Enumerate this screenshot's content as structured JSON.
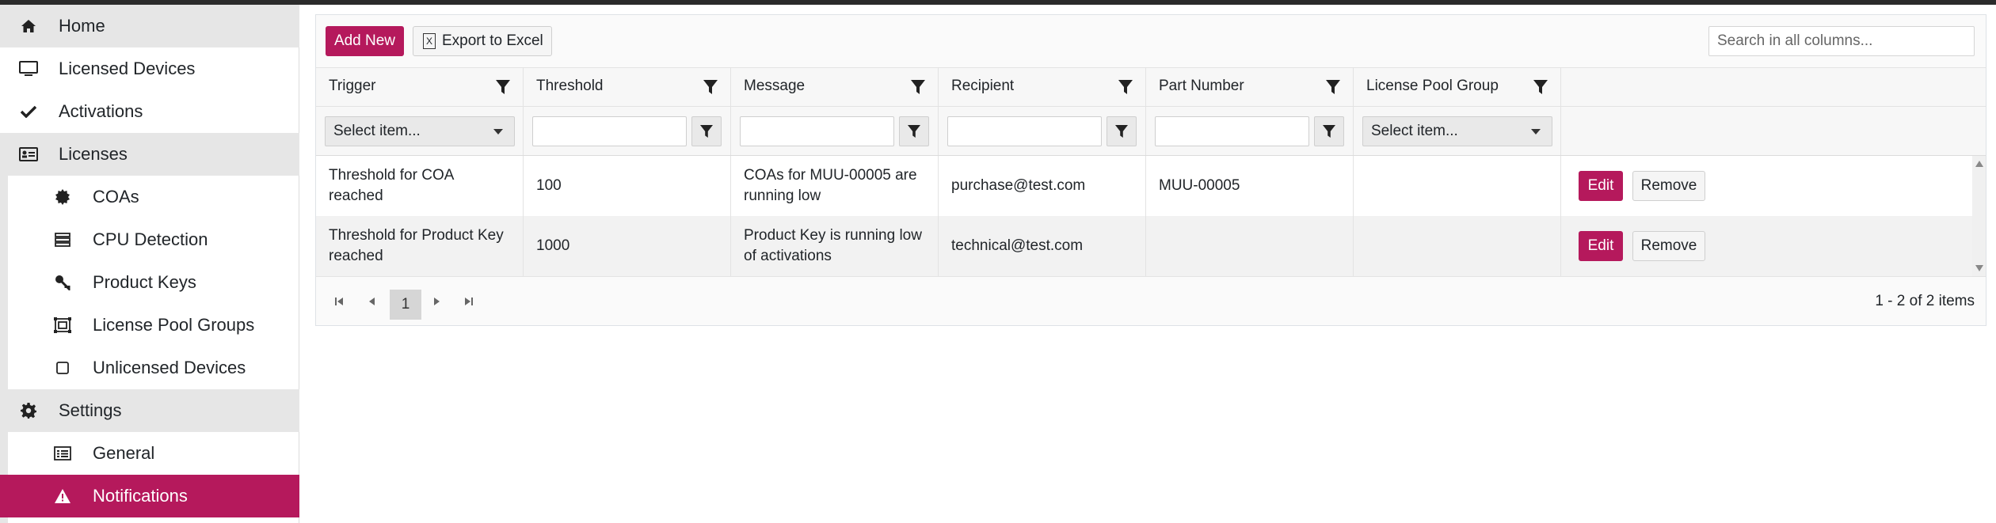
{
  "sidebar": {
    "home": "Home",
    "licensed_devices": "Licensed Devices",
    "activations": "Activations",
    "licenses": "Licenses",
    "coas": "COAs",
    "cpu_detection": "CPU Detection",
    "product_keys": "Product Keys",
    "license_pool_groups": "License Pool Groups",
    "unlicensed_devices": "Unlicensed Devices",
    "settings": "Settings",
    "general": "General",
    "notifications": "Notifications"
  },
  "toolbar": {
    "add_new": "Add New",
    "export": "Export to Excel",
    "search_placeholder": "Search in all columns..."
  },
  "columns": [
    "Trigger",
    "Threshold",
    "Message",
    "Recipient",
    "Part Number",
    "License Pool Group"
  ],
  "filters": {
    "select_placeholder": "Select item..."
  },
  "rows": [
    {
      "trigger": "Threshold for COA reached",
      "threshold": "100",
      "message": "COAs for MUU-00005 are running low",
      "recipient": "purchase@test.com",
      "part_number": "MUU-00005",
      "license_pool_group": ""
    },
    {
      "trigger": "Threshold for Product Key reached",
      "threshold": "1000",
      "message": "Product Key is running low of activations",
      "recipient": "technical@test.com",
      "part_number": "",
      "license_pool_group": ""
    }
  ],
  "actions": {
    "edit": "Edit",
    "remove": "Remove"
  },
  "pager": {
    "current_page": "1",
    "info": "1 - 2 of 2 items"
  },
  "colors": {
    "accent": "#b5195c"
  }
}
